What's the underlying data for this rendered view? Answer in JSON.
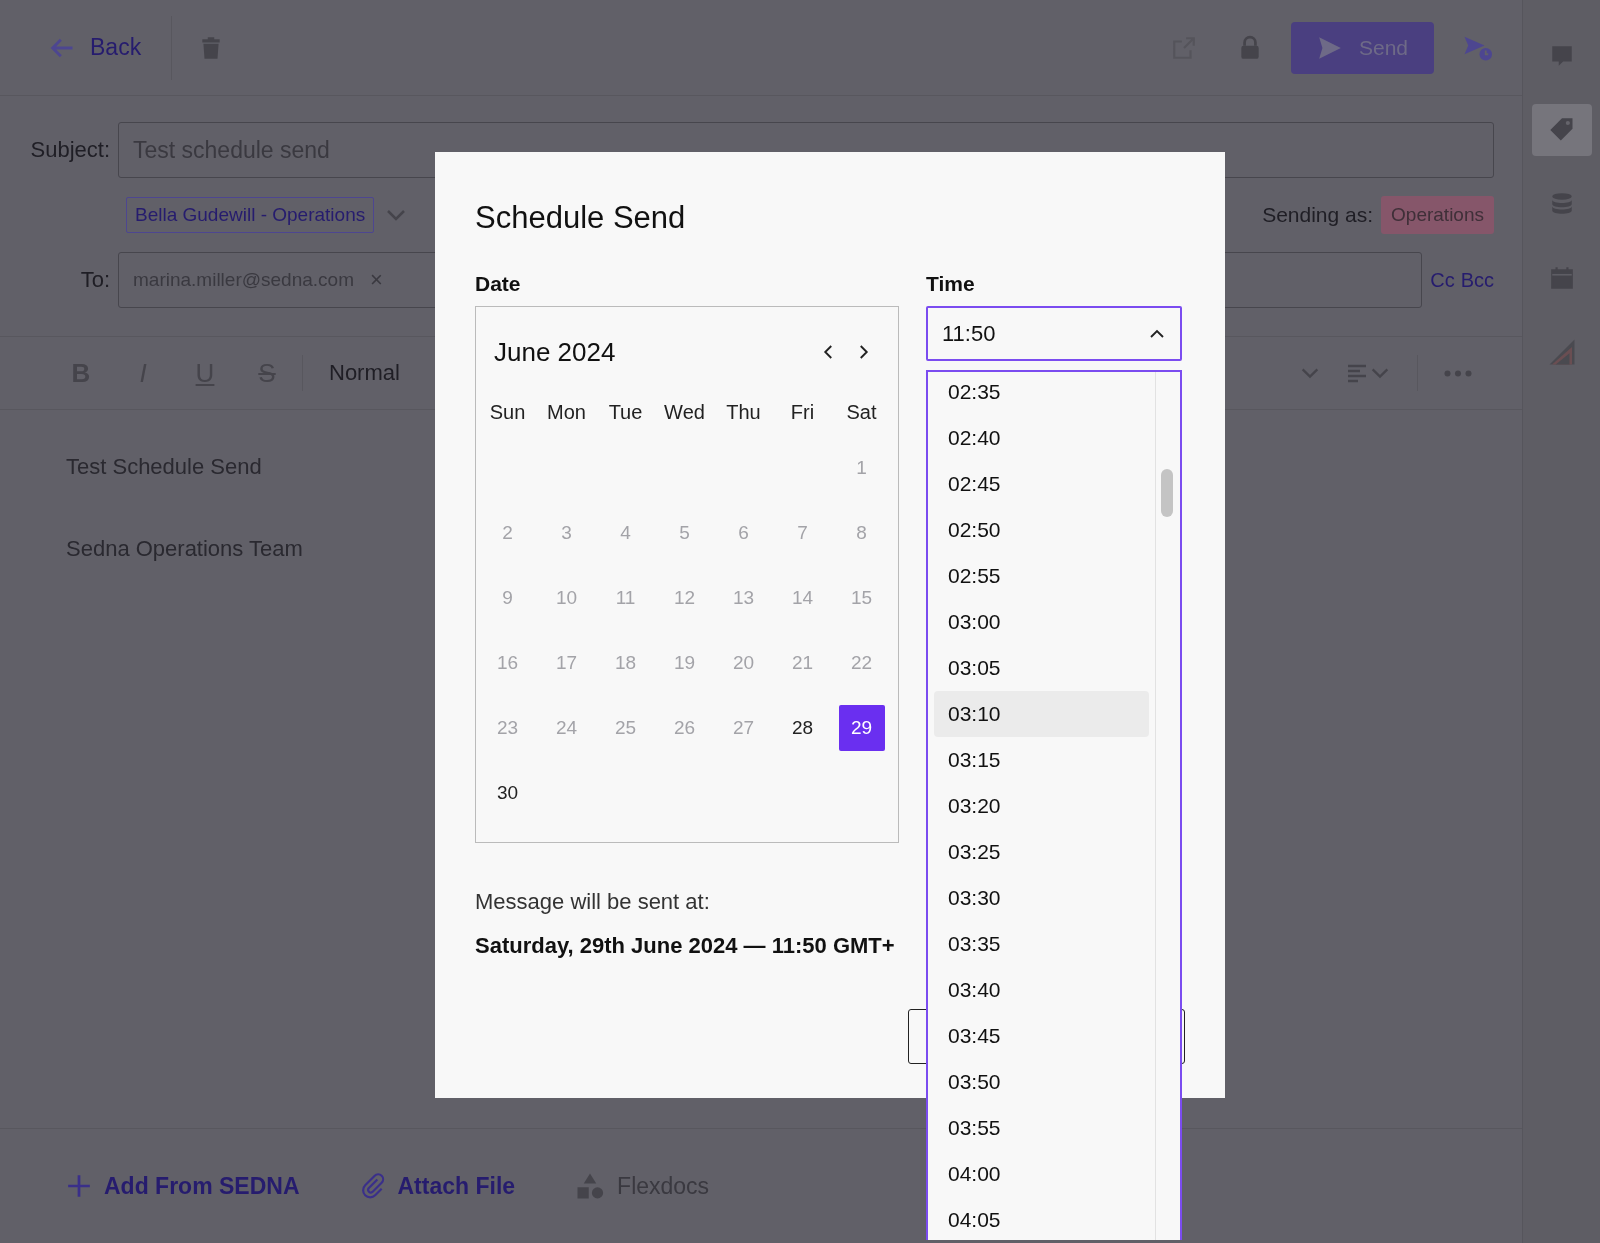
{
  "header": {
    "back": "Back",
    "send": "Send"
  },
  "compose": {
    "subject_label": "Subject:",
    "subject": "Test schedule send",
    "from": "Bella Gudewill - Operations",
    "sending_as_label": "Sending as:",
    "sending_as": "Operations",
    "to_label": "To:",
    "recipients": [
      {
        "email": "marina.miller@sedna.com",
        "remove": "×"
      }
    ],
    "cc": "Cc",
    "bcc": "Bcc"
  },
  "format_buttons": [
    {
      "label": "B",
      "kind": "bold"
    },
    {
      "label": "I",
      "kind": "italic"
    },
    {
      "label": "U",
      "kind": "underline"
    },
    {
      "label": "S",
      "kind": "strike"
    }
  ],
  "text_style": "Normal",
  "body": [
    "Test Schedule Send",
    "Sedna Operations Team"
  ],
  "attachments": [
    {
      "label": "Add From SEDNA",
      "kind": "add",
      "disabled": false
    },
    {
      "label": "Attach File",
      "kind": "attach",
      "disabled": false
    },
    {
      "label": "Flexdocs",
      "kind": "shapes",
      "disabled": true
    }
  ],
  "sidebar": [
    {
      "kind": "comment",
      "selected": false
    },
    {
      "kind": "tag",
      "selected": true
    },
    {
      "kind": "database",
      "selected": false
    },
    {
      "kind": "calendar",
      "selected": false
    },
    {
      "kind": "logo",
      "selected": false
    }
  ],
  "dialog": {
    "title": "Schedule Send",
    "date_label": "Date",
    "month": "June 2024",
    "weekdays": [
      "Sun",
      "Mon",
      "Tue",
      "Wed",
      "Thu",
      "Fri",
      "Sat"
    ],
    "weeks": [
      [
        {
          "label": "1",
          "disabled": true,
          "selected": false
        }
      ],
      [
        {
          "label": "2",
          "disabled": true,
          "selected": false
        },
        {
          "label": "3",
          "disabled": true,
          "selected": false
        },
        {
          "label": "4",
          "disabled": true,
          "selected": false
        },
        {
          "label": "5",
          "disabled": true,
          "selected": false
        },
        {
          "label": "6",
          "disabled": true,
          "selected": false
        },
        {
          "label": "7",
          "disabled": true,
          "selected": false
        },
        {
          "label": "8",
          "disabled": true,
          "selected": false
        }
      ],
      [
        {
          "label": "9",
          "disabled": true,
          "selected": false
        },
        {
          "label": "10",
          "disabled": true,
          "selected": false
        },
        {
          "label": "11",
          "disabled": true,
          "selected": false
        },
        {
          "label": "12",
          "disabled": true,
          "selected": false
        },
        {
          "label": "13",
          "disabled": true,
          "selected": false
        },
        {
          "label": "14",
          "disabled": true,
          "selected": false
        },
        {
          "label": "15",
          "disabled": true,
          "selected": false
        }
      ],
      [
        {
          "label": "16",
          "disabled": true,
          "selected": false
        },
        {
          "label": "17",
          "disabled": true,
          "selected": false
        },
        {
          "label": "18",
          "disabled": true,
          "selected": false
        },
        {
          "label": "19",
          "disabled": true,
          "selected": false
        },
        {
          "label": "20",
          "disabled": true,
          "selected": false
        },
        {
          "label": "21",
          "disabled": true,
          "selected": false
        },
        {
          "label": "22",
          "disabled": true,
          "selected": false
        }
      ],
      [
        {
          "label": "23",
          "disabled": true,
          "selected": false
        },
        {
          "label": "24",
          "disabled": true,
          "selected": false
        },
        {
          "label": "25",
          "disabled": true,
          "selected": false
        },
        {
          "label": "26",
          "disabled": true,
          "selected": false
        },
        {
          "label": "27",
          "disabled": true,
          "selected": false
        },
        {
          "label": "28",
          "disabled": false,
          "selected": false
        },
        {
          "label": "29",
          "disabled": false,
          "selected": true
        }
      ],
      [
        {
          "label": "30",
          "disabled": false,
          "selected": false
        }
      ]
    ],
    "time_label": "Time",
    "time_value": "11:50",
    "time_expanded": true,
    "time_options": [
      {
        "label": "02:35",
        "highlighted": false
      },
      {
        "label": "02:40",
        "highlighted": false
      },
      {
        "label": "02:45",
        "highlighted": false
      },
      {
        "label": "02:50",
        "highlighted": false
      },
      {
        "label": "02:55",
        "highlighted": false
      },
      {
        "label": "03:00",
        "highlighted": false
      },
      {
        "label": "03:05",
        "highlighted": false
      },
      {
        "label": "03:10",
        "highlighted": true
      },
      {
        "label": "03:15",
        "highlighted": false
      },
      {
        "label": "03:20",
        "highlighted": false
      },
      {
        "label": "03:25",
        "highlighted": false
      },
      {
        "label": "03:30",
        "highlighted": false
      },
      {
        "label": "03:35",
        "highlighted": false
      },
      {
        "label": "03:40",
        "highlighted": false
      },
      {
        "label": "03:45",
        "highlighted": false
      },
      {
        "label": "03:50",
        "highlighted": false
      },
      {
        "label": "03:55",
        "highlighted": false
      },
      {
        "label": "04:00",
        "highlighted": false
      },
      {
        "label": "04:05",
        "highlighted": false
      }
    ],
    "summary_label": "Message will be sent at:",
    "summary": "Saturday, 29th June 2024 — 11:50 GMT+"
  }
}
